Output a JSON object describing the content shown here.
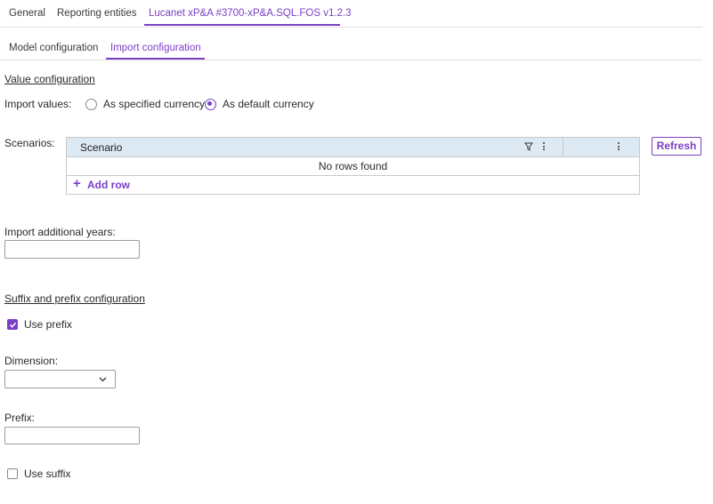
{
  "top_tabs": [
    {
      "label": "General"
    },
    {
      "label": "Reporting entities"
    },
    {
      "label": "Lucanet xP&A #3700-xP&A.SQL.FOS v1.2.3",
      "active": true
    }
  ],
  "sub_tabs": [
    {
      "label": "Model configuration"
    },
    {
      "label": "Import configuration",
      "active": true
    }
  ],
  "value_config": {
    "title": "Value configuration",
    "import_values_label": "Import values:",
    "options": [
      {
        "label": "As specified currency",
        "checked": false
      },
      {
        "label": "As default currency",
        "checked": true
      }
    ]
  },
  "scenarios": {
    "label": "Scenarios:",
    "column_header": "Scenario",
    "empty_text": "No rows found",
    "add_row_label": "Add row",
    "refresh_label": "Refresh"
  },
  "additional_years": {
    "label": "Import additional years:",
    "value": ""
  },
  "affix_config": {
    "title": "Suffix and prefix configuration",
    "use_prefix_label": "Use prefix",
    "use_prefix_checked": true,
    "dimension_label": "Dimension:",
    "dimension_value": "",
    "prefix_label": "Prefix:",
    "prefix_value": "",
    "use_suffix_label": "Use suffix",
    "use_suffix_checked": false
  },
  "colors": {
    "accent": "#7b3fc6",
    "grid_header": "#dde9f3"
  }
}
